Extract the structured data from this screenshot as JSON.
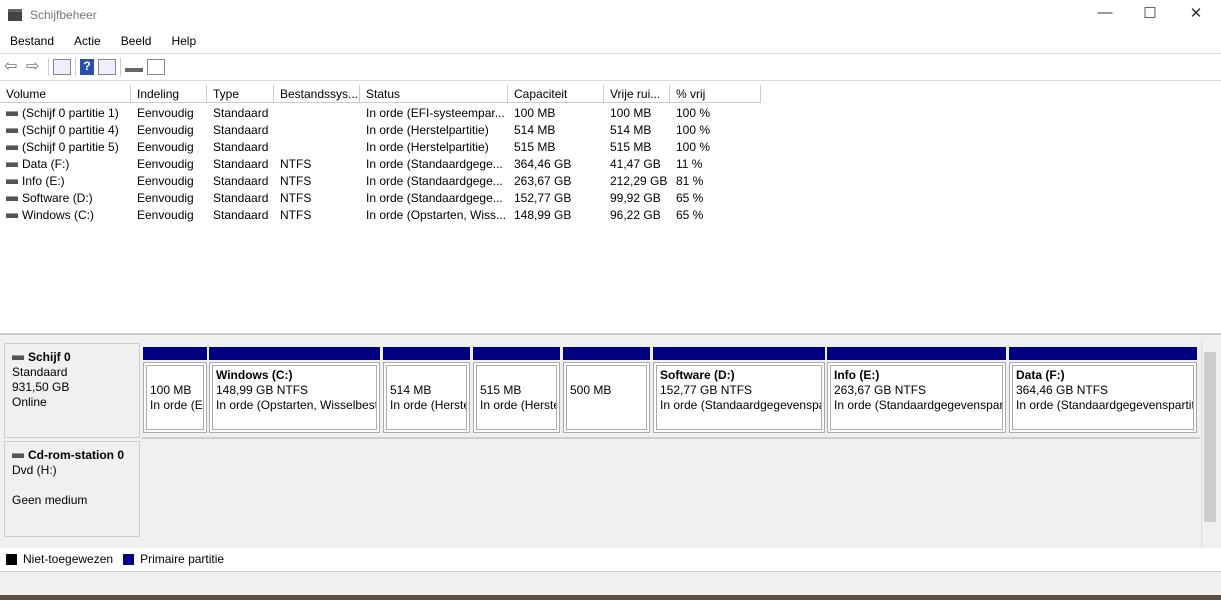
{
  "window": {
    "title": "Schijfbeheer",
    "minimize": "—",
    "maximize": "☐",
    "close": "✕"
  },
  "menu": [
    "Bestand",
    "Actie",
    "Beeld",
    "Help"
  ],
  "toolbar": [
    "back-icon",
    "forward-icon",
    "console-tree-icon",
    "help-icon",
    "action-pane-icon",
    "connect-icon",
    "properties-icon"
  ],
  "columns": [
    "Volume",
    "Indeling",
    "Type",
    "Bestandssys...",
    "Status",
    "Capaciteit",
    "Vrije rui...",
    "% vrij"
  ],
  "rows": [
    [
      "(Schijf 0 partitie 1)",
      "Eenvoudig",
      "Standaard",
      "",
      "In orde (EFI-systeempar...",
      "100 MB",
      "100 MB",
      "100 %"
    ],
    [
      "(Schijf 0 partitie 4)",
      "Eenvoudig",
      "Standaard",
      "",
      "In orde (Herstelpartitie)",
      "514 MB",
      "514 MB",
      "100 %"
    ],
    [
      "(Schijf 0 partitie 5)",
      "Eenvoudig",
      "Standaard",
      "",
      "In orde (Herstelpartitie)",
      "515 MB",
      "515 MB",
      "100 %"
    ],
    [
      "Data (F:)",
      "Eenvoudig",
      "Standaard",
      "NTFS",
      "In orde (Standaardgege...",
      "364,46 GB",
      "41,47 GB",
      "11 %"
    ],
    [
      "Info (E:)",
      "Eenvoudig",
      "Standaard",
      "NTFS",
      "In orde (Standaardgege...",
      "263,67 GB",
      "212,29 GB",
      "81 %"
    ],
    [
      "Software (D:)",
      "Eenvoudig",
      "Standaard",
      "NTFS",
      "In orde (Standaardgege...",
      "152,77 GB",
      "99,92 GB",
      "65 %"
    ],
    [
      "Windows (C:)",
      "Eenvoudig",
      "Standaard",
      "NTFS",
      "In orde (Opstarten, Wiss...",
      "148,99 GB",
      "96,22 GB",
      "65 %"
    ]
  ],
  "disk0": {
    "name": "Schijf 0",
    "type": "Standaard",
    "size": "931,50 GB",
    "state": "Online",
    "partitions": [
      {
        "name": "",
        "size": "100 MB",
        "status": "In orde (E"
      },
      {
        "name": "Windows  (C:)",
        "size": "148,99 GB NTFS",
        "status": "In orde (Opstarten, Wisselbest"
      },
      {
        "name": "",
        "size": "514 MB",
        "status": "In orde (Herste"
      },
      {
        "name": "",
        "size": "515 MB",
        "status": "In orde (Herste"
      },
      {
        "name": "",
        "size": "500 MB",
        "status": ""
      },
      {
        "name": "Software  (D:)",
        "size": "152,77 GB NTFS",
        "status": "In orde (Standaardgegevenspa"
      },
      {
        "name": "Info  (E:)",
        "size": "263,67 GB NTFS",
        "status": "In orde (Standaardgegevenspart"
      },
      {
        "name": "Data  (F:)",
        "size": "364,46 GB NTFS",
        "status": "In orde (Standaardgegevenspartit"
      }
    ]
  },
  "cdrom": {
    "name": "Cd-rom-station 0",
    "drive": "Dvd (H:)",
    "state": "Geen medium"
  },
  "legend": [
    {
      "label": "Niet-toegewezen",
      "color": "#000000"
    },
    {
      "label": "Primaire partitie",
      "color": "#000080"
    }
  ]
}
